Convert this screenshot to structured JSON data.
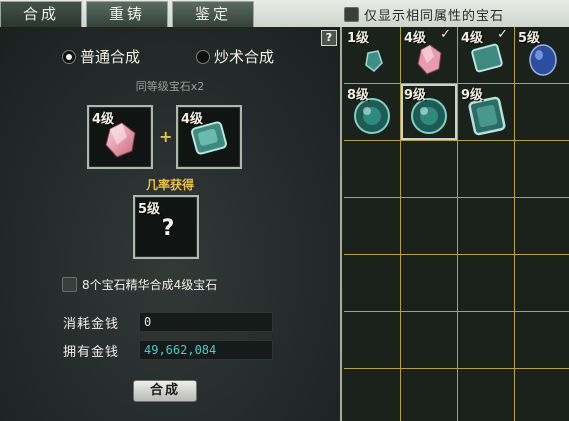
{
  "tabs": [
    "合成",
    "重铸",
    "鉴定"
  ],
  "filter": {
    "label": "仅显示相同属性的宝石",
    "checked": false
  },
  "help": "?",
  "modes": {
    "normal": "普通合成",
    "skill": "炒术合成",
    "selected": "normal"
  },
  "subtitle": "同等级宝石x2",
  "inputs": [
    {
      "level": "4级",
      "gem": "pink-crystal-icon"
    },
    {
      "level": "4级",
      "gem": "green-cube-icon"
    }
  ],
  "plus": "+",
  "chance_label": "几率获得",
  "result": {
    "level": "5级",
    "icon": "question-mark-icon",
    "text": "?"
  },
  "essence": {
    "label": "8个宝石精华合成4级宝石",
    "checked": false
  },
  "money": {
    "cost_label": "消耗金钱",
    "cost_value": "0",
    "have_label": "拥有金钱",
    "have_value": "49,662,084",
    "have_color": "#3fd0d0"
  },
  "combine_button": "合成",
  "inventory": [
    {
      "level": "1级",
      "gem": "small-teal-gem-icon",
      "checked": false
    },
    {
      "level": "4级",
      "gem": "pink-crystal-icon",
      "checked": true
    },
    {
      "level": "4级",
      "gem": "green-cube-icon",
      "checked": true
    },
    {
      "level": "5级",
      "gem": "blue-gem-icon",
      "checked": false
    },
    {
      "level": "8级",
      "gem": "jade-orb-icon",
      "checked": false
    },
    {
      "level": "9级",
      "gem": "jade-orb-icon",
      "checked": false,
      "selected": true
    },
    {
      "level": "9级",
      "gem": "jade-cube-icon",
      "checked": false
    }
  ],
  "check_mark": "✓"
}
